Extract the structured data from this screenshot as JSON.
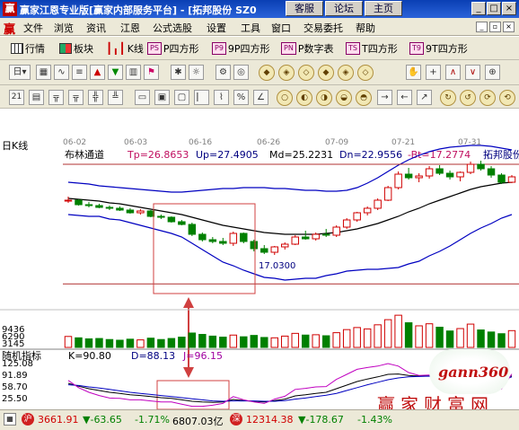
{
  "window": {
    "title": "赢家江恩专业版[赢家内部服务平台] - [拓邦股份  SZ0",
    "tabs": [
      "客服",
      "论坛",
      "主页"
    ],
    "controls": [
      "_",
      "□",
      "×"
    ]
  },
  "menu": {
    "logo": "赢",
    "items": [
      "文件",
      "浏览",
      "资讯",
      "江恩",
      "公式选股",
      "设置",
      "工具",
      "窗口",
      "交易委托",
      "帮助"
    ]
  },
  "toolbar1": {
    "items": [
      {
        "icon": "grid-icon",
        "label": "行情"
      },
      {
        "icon": "block-icon",
        "label": "板块"
      },
      {
        "icon": "kline-icon",
        "label": "K线"
      },
      {
        "icon": "p-square-icon",
        "badge": "PS",
        "label": "P四方形"
      },
      {
        "icon": "9p-square-icon",
        "badge": "P9",
        "label": "9P四方形"
      },
      {
        "icon": "p-number-icon",
        "badge": "PN",
        "label": "P数字表"
      },
      {
        "icon": "t-square-icon",
        "badge": "TS",
        "label": "T四方形"
      },
      {
        "icon": "9t-square-icon",
        "badge": "T9",
        "label": "9T四方形"
      }
    ]
  },
  "toolbar2": {
    "day_label": "日",
    "icons": [
      "calculator-icon",
      "line-chart-icon",
      "table-icon",
      "up-arrow-icon",
      "down-arrow-icon",
      "bars-icon",
      "flag-icon",
      "star-icon",
      "diamond-icon",
      "hand-icon",
      "crosshair-icon",
      "wave-icon",
      "ratio-icon"
    ]
  },
  "toolbar3": {
    "icons": [
      "calendar-21-icon",
      "ruler-icon",
      "gann-fan-icon",
      "percent-icon",
      "circle-icon",
      "arrow-right-icon"
    ]
  },
  "chart_header": {
    "period": "日K线",
    "indicator": "布林通道",
    "tp": "Tp=26.8653",
    "up": "Up=27.4905",
    "md": "Md=25.2231",
    "dn": "Dn=22.9556",
    "bt": "-Bt=17.2774",
    "stock": "拓邦股份",
    "dates": [
      "06-02",
      "06-03",
      "06-16",
      "06-26",
      "07-09",
      "07-21",
      "07-31"
    ],
    "low_label": "17.0300"
  },
  "volume": {
    "ticks": [
      "9436",
      "6290",
      "3145"
    ]
  },
  "kdj": {
    "name": "随机指标",
    "k": "K=90.80",
    "d": "D=88.13",
    "j": "J=96.15",
    "ticks": [
      "125.08",
      "91.89",
      "58.70",
      "25.50"
    ]
  },
  "chart_data": {
    "type": "candlestick",
    "candles": [
      [
        26.5,
        27.0,
        26.3,
        26.6
      ],
      [
        26.6,
        26.7,
        26.0,
        26.1
      ],
      [
        26.1,
        26.4,
        25.8,
        26.0
      ],
      [
        26.0,
        26.2,
        25.7,
        25.8
      ],
      [
        25.8,
        26.0,
        25.5,
        25.7
      ],
      [
        25.7,
        25.9,
        25.4,
        25.5
      ],
      [
        25.5,
        25.7,
        25.1,
        25.2
      ],
      [
        25.2,
        25.6,
        25.0,
        25.4
      ],
      [
        25.4,
        25.5,
        24.7,
        24.8
      ],
      [
        24.8,
        25.0,
        24.5,
        24.7
      ],
      [
        24.7,
        24.8,
        24.1,
        24.2
      ],
      [
        24.2,
        24.4,
        23.8,
        23.9
      ],
      [
        23.9,
        24.1,
        22.6,
        22.8
      ],
      [
        22.8,
        23.0,
        22.0,
        22.2
      ],
      [
        22.2,
        22.5,
        21.8,
        22.0
      ],
      [
        22.0,
        22.4,
        21.6,
        21.8
      ],
      [
        21.8,
        23.1,
        21.5,
        22.9
      ],
      [
        22.9,
        23.0,
        21.8,
        22.0
      ],
      [
        22.0,
        22.2,
        20.9,
        21.2
      ],
      [
        21.2,
        21.6,
        20.6,
        20.8
      ],
      [
        20.8,
        21.5,
        20.5,
        21.4
      ],
      [
        21.4,
        21.9,
        21.1,
        21.7
      ],
      [
        21.7,
        22.7,
        21.6,
        22.5
      ],
      [
        22.5,
        23.2,
        22.2,
        22.3
      ],
      [
        22.3,
        23.0,
        22.1,
        22.8
      ],
      [
        22.8,
        23.4,
        22.5,
        22.7
      ],
      [
        22.7,
        23.8,
        22.5,
        23.6
      ],
      [
        23.6,
        24.6,
        23.4,
        24.4
      ],
      [
        24.4,
        25.3,
        24.2,
        25.2
      ],
      [
        25.2,
        25.9,
        24.9,
        25.7
      ],
      [
        25.7,
        26.8,
        25.5,
        26.6
      ],
      [
        26.6,
        28.2,
        26.5,
        28.0
      ],
      [
        28.0,
        29.8,
        27.8,
        29.5
      ],
      [
        29.5,
        30.2,
        28.9,
        29.1
      ],
      [
        29.1,
        29.6,
        28.6,
        29.3
      ],
      [
        29.3,
        30.4,
        29.0,
        30.1
      ],
      [
        30.1,
        30.5,
        29.4,
        29.6
      ],
      [
        29.6,
        29.9,
        28.9,
        29.2
      ],
      [
        29.2,
        29.8,
        28.7,
        29.7
      ],
      [
        29.7,
        30.9,
        29.5,
        30.6
      ],
      [
        30.6,
        31.0,
        29.9,
        30.1
      ],
      [
        30.1,
        30.4,
        29.1,
        29.4
      ],
      [
        29.4,
        29.6,
        28.4,
        28.6
      ],
      [
        28.6,
        29.4,
        28.5,
        29.2
      ]
    ],
    "volume": [
      3200,
      2800,
      2500,
      2600,
      2300,
      2100,
      2400,
      2200,
      2700,
      2300,
      2600,
      3000,
      4200,
      3800,
      3300,
      3000,
      3600,
      3100,
      3500,
      2900,
      2800,
      3300,
      4100,
      3600,
      3700,
      3400,
      4300,
      5200,
      5800,
      5400,
      6600,
      8100,
      9400,
      7200,
      6300,
      6900,
      5900,
      4800,
      5500,
      6800,
      5100,
      4500,
      4000,
      4900
    ],
    "bollinger": {
      "upper": [
        28.6,
        28.5,
        28.4,
        28.2,
        28.1,
        28.0,
        27.9,
        27.8,
        27.7,
        27.6,
        27.5,
        27.5,
        27.6,
        27.7,
        27.8,
        27.9,
        27.9,
        28.0,
        28.0,
        28.0,
        27.9,
        27.9,
        27.8,
        27.7,
        27.7,
        27.6,
        27.6,
        27.7,
        28.0,
        28.5,
        29.1,
        29.8,
        30.5,
        31.1,
        31.6,
        32.0,
        32.3,
        32.5,
        32.6,
        32.7,
        32.7,
        32.6,
        32.4,
        32.2
      ],
      "middle": [
        26.8,
        26.7,
        26.6,
        26.5,
        26.3,
        26.2,
        26.0,
        25.8,
        25.6,
        25.4,
        25.2,
        25.0,
        24.7,
        24.4,
        24.1,
        23.8,
        23.6,
        23.4,
        23.2,
        23.0,
        22.9,
        22.8,
        22.8,
        22.8,
        22.8,
        22.9,
        23.0,
        23.2,
        23.4,
        23.7,
        24.0,
        24.4,
        24.8,
        25.3,
        25.7,
        26.2,
        26.6,
        27.0,
        27.4,
        27.8,
        28.1,
        28.3,
        28.5,
        28.6
      ],
      "lower": [
        25.0,
        24.9,
        24.8,
        24.8,
        24.5,
        24.4,
        24.1,
        23.8,
        23.5,
        23.2,
        22.9,
        22.5,
        21.8,
        21.1,
        20.4,
        19.7,
        19.3,
        18.8,
        18.4,
        18.0,
        17.9,
        17.7,
        17.8,
        17.9,
        17.9,
        18.2,
        18.4,
        18.7,
        18.8,
        18.9,
        18.9,
        19.0,
        19.1,
        19.5,
        19.8,
        20.4,
        20.9,
        21.5,
        22.2,
        22.9,
        23.5,
        24.0,
        24.6,
        25.0
      ]
    },
    "kdj": {
      "k": [
        70,
        62,
        55,
        50,
        45,
        42,
        38,
        36,
        33,
        30,
        28,
        24,
        20,
        18,
        17,
        18,
        25,
        22,
        20,
        18,
        22,
        26,
        35,
        38,
        42,
        45,
        55,
        65,
        75,
        82,
        88,
        95,
        96,
        92,
        90,
        91,
        88,
        82,
        80,
        86,
        84,
        76,
        70,
        91
      ],
      "d": [
        66,
        64,
        60,
        57,
        53,
        49,
        45,
        42,
        39,
        36,
        33,
        30,
        27,
        24,
        21,
        20,
        21,
        21,
        21,
        20,
        20,
        22,
        26,
        29,
        33,
        37,
        42,
        50,
        58,
        66,
        73,
        80,
        85,
        88,
        89,
        90,
        89,
        87,
        85,
        85,
        85,
        82,
        78,
        88
      ],
      "j": [
        78,
        58,
        45,
        36,
        29,
        28,
        24,
        24,
        21,
        18,
        18,
        12,
        6,
        6,
        9,
        14,
        33,
        24,
        18,
        14,
        26,
        34,
        53,
        56,
        60,
        61,
        81,
        95,
        109,
        114,
        118,
        125,
        118,
        100,
        92,
        93,
        86,
        72,
        70,
        88,
        82,
        64,
        54,
        96
      ]
    }
  },
  "status": {
    "index1": "3661.91",
    "chg1": "-63.65",
    "pct1": "-1.71%",
    "amt1": "6807.03亿",
    "index2": "12314.38",
    "chg2": "-178.67",
    "pct2": "-1.43%",
    "hu": "沪",
    "shen": "深"
  },
  "watermark": {
    "site": "gann360",
    "slogan": "赢家财富网"
  }
}
